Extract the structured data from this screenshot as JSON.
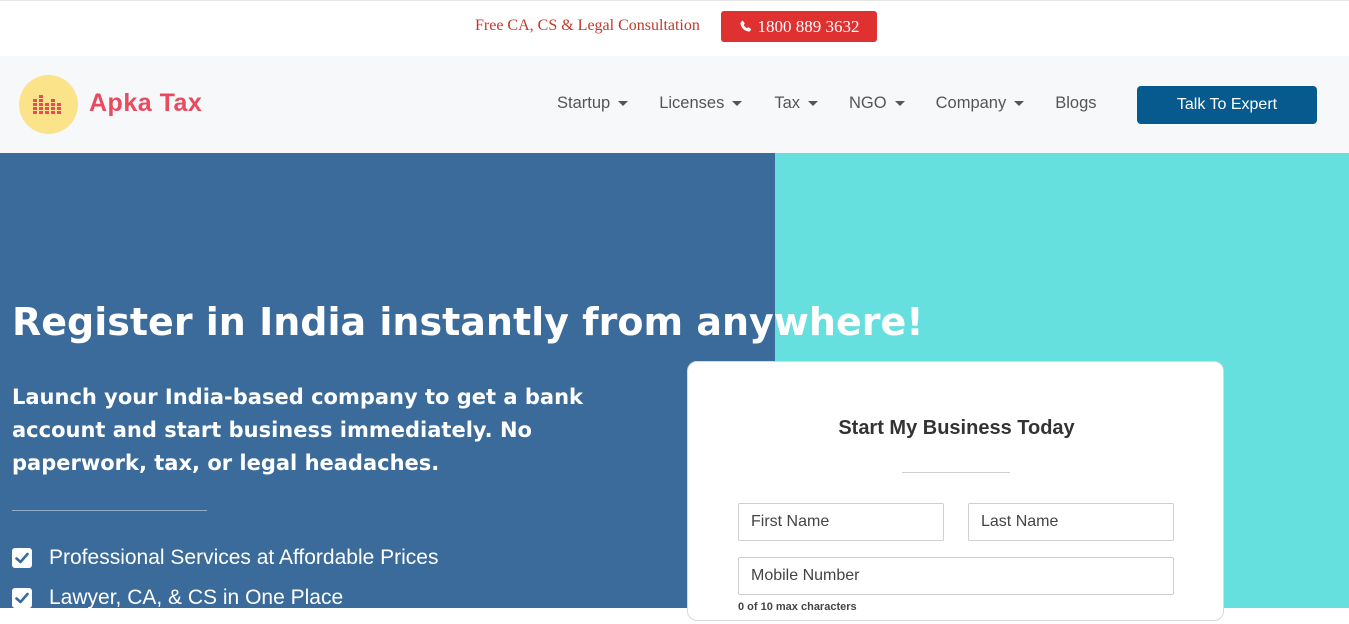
{
  "topbar": {
    "promo_text": "Free CA, CS & Legal Consultation",
    "phone_label": "1800 889 3632",
    "phone_icon": "phone-icon"
  },
  "navbar": {
    "brand": "Apka Tax",
    "logo_icon": "bar-chart-icon",
    "items": [
      {
        "label": "Startup",
        "dropdown": true
      },
      {
        "label": "Licenses",
        "dropdown": true
      },
      {
        "label": "Tax",
        "dropdown": true
      },
      {
        "label": "NGO",
        "dropdown": true
      },
      {
        "label": "Company",
        "dropdown": true
      },
      {
        "label": "Blogs",
        "dropdown": false
      }
    ],
    "cta_label": "Talk To Expert"
  },
  "hero": {
    "headline": "Register in India instantly from anywhere!",
    "subhead": "Launch your India-based company to get a bank account and start business immediately. No paperwork, tax, or legal headaches.",
    "features": [
      "Professional Services at Affordable Prices",
      "Lawyer, CA, & CS in One Place"
    ]
  },
  "form": {
    "title": "Start My Business Today",
    "first_name_placeholder": "First Name",
    "last_name_placeholder": "Last Name",
    "mobile_placeholder": "Mobile Number",
    "mobile_hint": "0 of 10 max characters"
  },
  "colors": {
    "accent_red": "#e03131",
    "brand_pink": "#e84a5f",
    "cta_blue": "#065a8e",
    "hero_blue": "#3a6b9a",
    "hero_teal": "#66dfdf"
  }
}
